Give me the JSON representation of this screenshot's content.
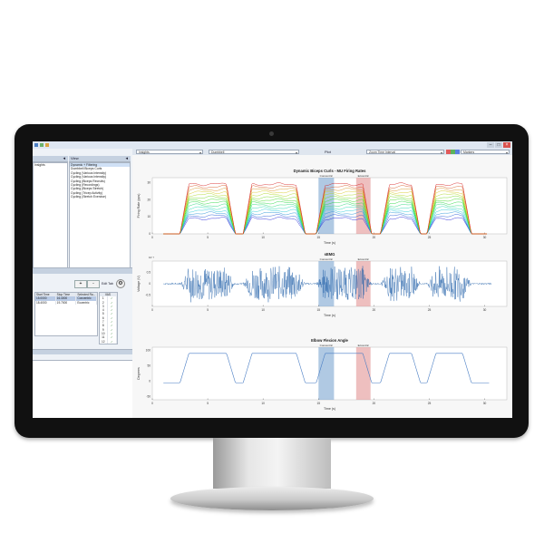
{
  "toolbar": {
    "dropdown1": "Insights",
    "dropdown2": "Dumbbell",
    "plot_label": "Plot",
    "zoom_dropdown": "Zoom Time Interval",
    "right_dropdown": "Markers"
  },
  "left_panel": {
    "top_list_item": "Insights",
    "view_header": "View",
    "view_list": [
      "Dynamic + Filtering",
      "Dumbbell Biceps Curls",
      "Cycling (Various Intensity)",
      "Cycling (Various Intensity)",
      "Cycling (Biceps Recruits)",
      "Cycling (Recordings)",
      "Cycling (Biceps Stretch)",
      "Cycling (Tricep Activity)",
      "Cycling (Stretch Exercise)"
    ],
    "add_button": "+",
    "remove_button": "-",
    "edit_label": "Edit Tab",
    "table_headers": [
      "Start Time",
      "Stop Time",
      "Selected Ra..."
    ],
    "table_rows": [
      [
        "15.0000",
        "16.4000",
        "Concentric"
      ],
      [
        "18.4000",
        "19.7000",
        "Eccentric"
      ]
    ],
    "index_header": "VAS",
    "index_rows": [
      "1",
      "2",
      "3",
      "4",
      "5",
      "6",
      "7",
      "8",
      "9",
      "10",
      "11",
      "12"
    ]
  },
  "colors": {
    "concentric_band": "#6f9ccc",
    "eccentric_band": "#e08b8b",
    "emg_signal": "#1f5fa8",
    "angle_line": "#4a7ec4"
  },
  "plots": {
    "firing": {
      "title": "Dynamic Biceps Curls - MU Firing Rates",
      "ylabel": "Firing Rate (pps)",
      "xlabel": "Time (s)",
      "yticks": [
        "30",
        "20",
        "10",
        "0"
      ],
      "band_labels": [
        "Concentric",
        "Eccentric"
      ]
    },
    "semg": {
      "title": "sEMG",
      "ylabel": "Voltage (V)",
      "xlabel": "Time (s)",
      "exponent": "10⁻³",
      "yticks": [
        "0.5",
        "0",
        "-0.5"
      ],
      "band_labels": [
        "Concentric",
        "Eccentric"
      ]
    },
    "angle": {
      "title": "Elbow Flexion Angle",
      "ylabel": "Degrees",
      "xlabel": "Time (s)",
      "yticks": [
        "100",
        "50",
        "0",
        "-50"
      ],
      "band_labels": [
        "Concentric",
        "Eccentric"
      ]
    },
    "xticks": [
      "0",
      "5",
      "10",
      "15",
      "20",
      "25",
      "30"
    ]
  }
}
